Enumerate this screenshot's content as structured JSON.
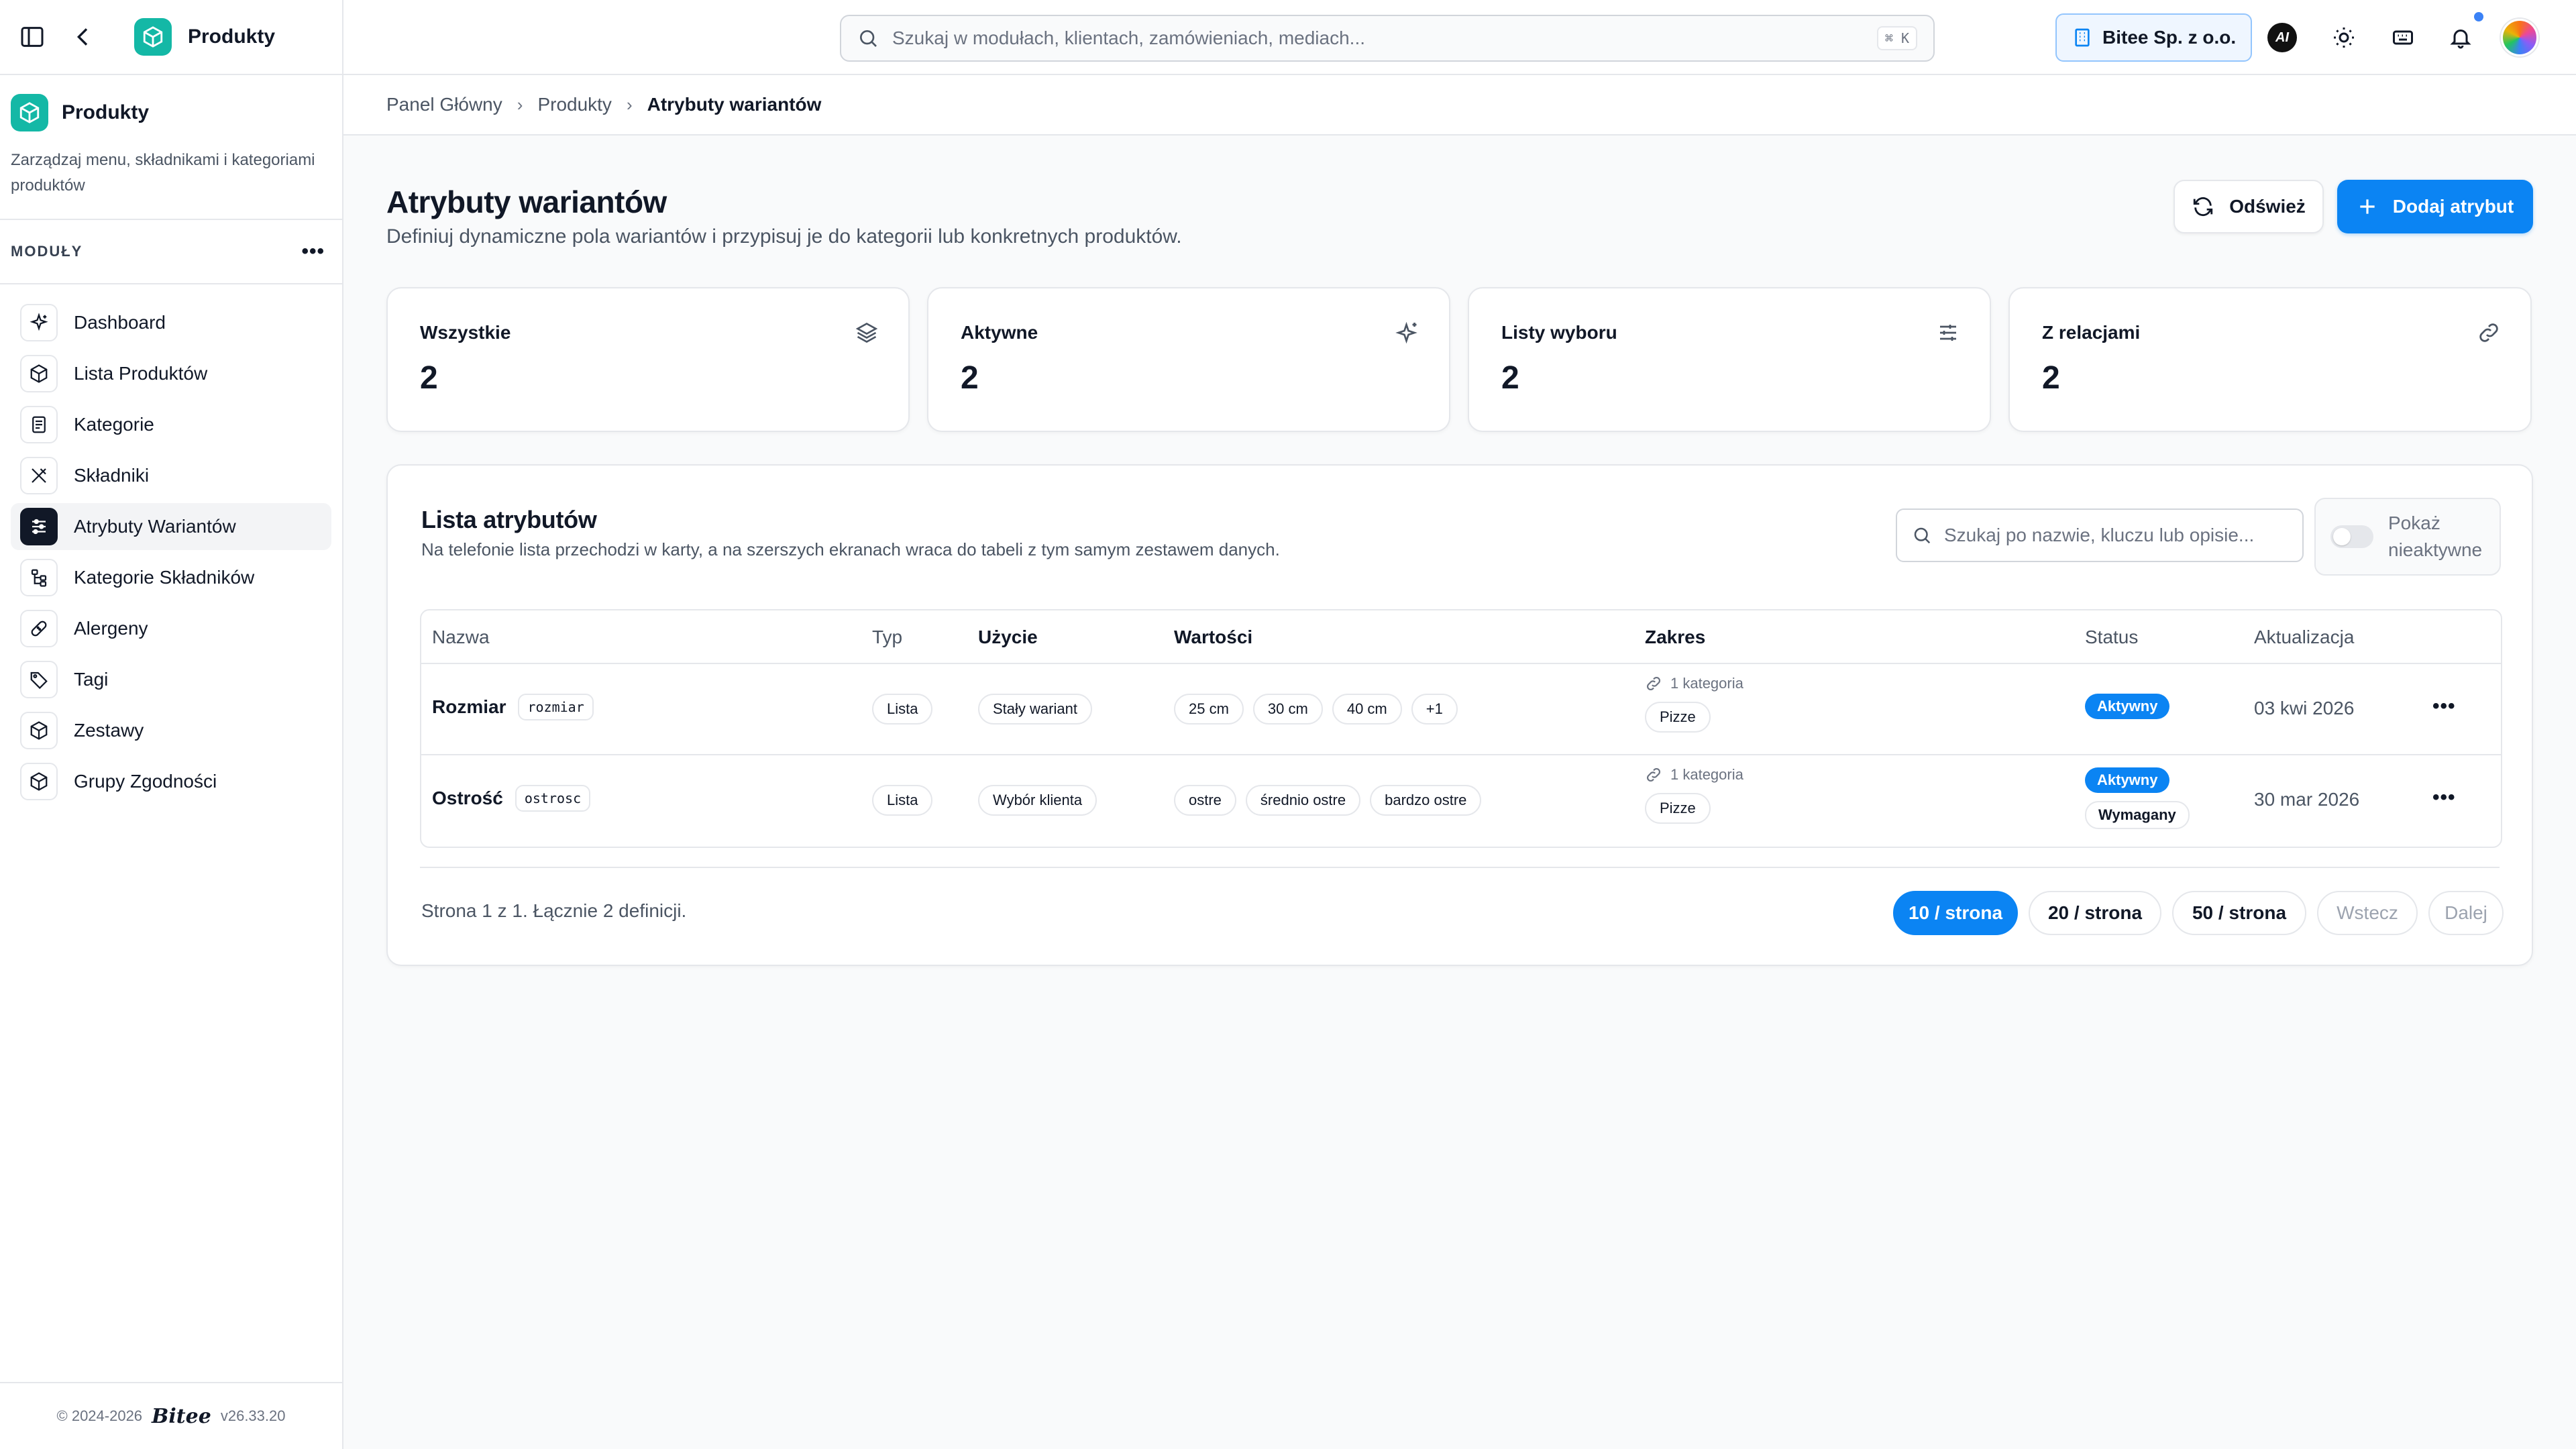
{
  "app": {
    "title": "Produkty"
  },
  "sidebar": {
    "section_title": "Produkty",
    "section_desc": "Zarządzaj menu, składnikami i kategoriami produktów",
    "modules_label": "MODUŁY",
    "items": [
      {
        "label": "Dashboard",
        "icon": "sparkles-icon"
      },
      {
        "label": "Lista Produktów",
        "icon": "box-icon"
      },
      {
        "label": "Kategorie",
        "icon": "document-icon"
      },
      {
        "label": "Składniki",
        "icon": "utensils-icon"
      },
      {
        "label": "Atrybuty Wariantów",
        "icon": "sliders-icon"
      },
      {
        "label": "Kategorie Składników",
        "icon": "tree-icon"
      },
      {
        "label": "Alergeny",
        "icon": "bandage-icon"
      },
      {
        "label": "Tagi",
        "icon": "tag-icon"
      },
      {
        "label": "Zestawy",
        "icon": "box-icon"
      },
      {
        "label": "Grupy Zgodności",
        "icon": "box-icon"
      }
    ],
    "footer_copyright": "© 2024-2026",
    "footer_brand": "Bitee",
    "footer_version": "v26.33.20"
  },
  "topbar": {
    "search_placeholder": "Szukaj w modułach, klientach, zamówieniach, mediach...",
    "search_shortcut": "⌘ K",
    "company": "Bitee Sp. z o.o.",
    "ai_label": "AI"
  },
  "breadcrumb": [
    "Panel Główny",
    "Produkty",
    "Atrybuty wariantów"
  ],
  "page": {
    "title": "Atrybuty wariantów",
    "subtitle": "Definiuj dynamiczne pola wariantów i przypisuj je do kategorii lub konkretnych produktów.",
    "refresh_label": "Odśwież",
    "add_label": "Dodaj atrybut"
  },
  "stats": [
    {
      "label": "Wszystkie",
      "value": "2",
      "icon": "layers-icon"
    },
    {
      "label": "Aktywne",
      "value": "2",
      "icon": "sparkles-icon"
    },
    {
      "label": "Listy wyboru",
      "value": "2",
      "icon": "sliders-icon"
    },
    {
      "label": "Z relacjami",
      "value": "2",
      "icon": "link-icon"
    }
  ],
  "list": {
    "title": "Lista atrybutów",
    "subtitle": "Na telefonie lista przechodzi w karty, a na szerszych ekranach wraca do tabeli z tym samym zestawem danych.",
    "search_placeholder": "Szukaj po nazwie, kluczu lub opisie...",
    "toggle_label_1": "Pokaż",
    "toggle_label_2": "nieaktywne",
    "columns": [
      "Nazwa",
      "Typ",
      "Użycie",
      "Wartości",
      "Zakres",
      "Status",
      "Aktualizacja"
    ],
    "rows": [
      {
        "name": "Rozmiar",
        "key": "rozmiar",
        "type": "Lista",
        "usage": "Stały wariant",
        "values": [
          "25 cm",
          "30 cm",
          "40 cm",
          "+1"
        ],
        "scope_count": "1 kategoria",
        "scope_item": "Pizze",
        "status": "Aktywny",
        "status_extra": "",
        "updated": "03 kwi 2026"
      },
      {
        "name": "Ostrość",
        "key": "ostrosc",
        "type": "Lista",
        "usage": "Wybór klienta",
        "values": [
          "ostre",
          "średnio ostre",
          "bardzo ostre"
        ],
        "scope_count": "1 kategoria",
        "scope_item": "Pizze",
        "status": "Aktywny",
        "status_extra": "Wymagany",
        "updated": "30 mar 2026"
      }
    ],
    "page_info": "Strona 1 z 1. Łącznie 2 definicji.",
    "page_sizes": [
      "10 / strona",
      "20 / strona",
      "50 / strona"
    ],
    "prev_label": "Wstecz",
    "next_label": "Dalej"
  }
}
